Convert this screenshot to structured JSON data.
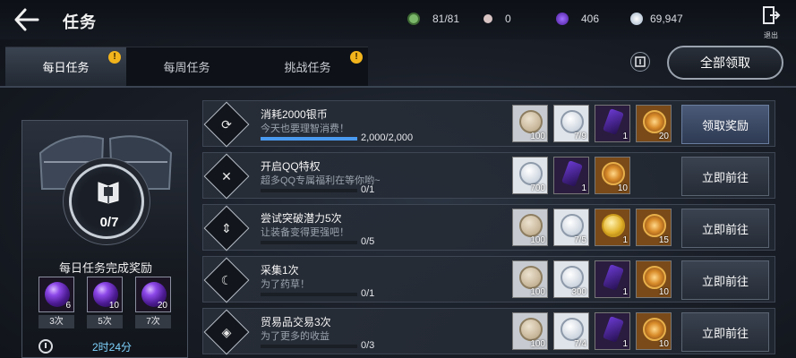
{
  "header": {
    "title": "任务",
    "exit_label": "退出"
  },
  "resources": [
    {
      "icon": "stamina-icon",
      "value": "81/81",
      "color": "#7bb86a"
    },
    {
      "icon": "pearl-icon",
      "value": "0",
      "color": "#d9c4c4"
    },
    {
      "icon": "purple-gem-icon",
      "value": "406",
      "color": "#7a3ee0"
    },
    {
      "icon": "silver-coin-icon",
      "value": "69,947",
      "color": "#c9d6e6"
    }
  ],
  "tabs": [
    {
      "label": "每日任务",
      "active": true,
      "badge": "!"
    },
    {
      "label": "每周任务",
      "active": false,
      "badge": ""
    },
    {
      "label": "挑战任务",
      "active": false,
      "badge": "!"
    }
  ],
  "claim_all_label": "全部领取",
  "daily_panel": {
    "count": "0/7",
    "title": "每日任务完成奖励",
    "rewards": [
      {
        "qty": "6",
        "label": "3次"
      },
      {
        "qty": "10",
        "label": "5次"
      },
      {
        "qty": "20",
        "label": "7次"
      }
    ],
    "timer": "2时24分"
  },
  "tasks": [
    {
      "name": "消耗2000银币",
      "desc": "今天也要理智消费！",
      "progress": "2,000/2,000",
      "progress_fraction": 1.0,
      "items": [
        {
          "type": "coin-tan",
          "bg": "bg-silver",
          "qty": "100"
        },
        {
          "type": "coin-silver",
          "bg": "bg-white",
          "qty": "7/9"
        },
        {
          "type": "gem",
          "bg": "bg-purple",
          "qty": "1"
        },
        {
          "type": "medal",
          "bg": "bg-gold",
          "qty": "20"
        }
      ],
      "button": "领取奖励",
      "claimable": true,
      "icon": "cycle-icon",
      "glyph": "⟳"
    },
    {
      "name": "开启QQ特权",
      "desc": "超多QQ专属福利在等你哟~",
      "progress": "0/1",
      "progress_fraction": 0,
      "items": [
        {
          "type": "coin-silver",
          "bg": "bg-white",
          "qty": "700"
        },
        {
          "type": "gem",
          "bg": "bg-purple",
          "qty": "1"
        },
        {
          "type": "medal",
          "bg": "bg-gold",
          "qty": "10"
        }
      ],
      "button": "立即前往",
      "claimable": false,
      "icon": "qq-privilege-icon",
      "glyph": "✕"
    },
    {
      "name": "尝试突破潜力5次",
      "desc": "让装备变得更强吧！",
      "progress": "0/5",
      "progress_fraction": 0,
      "items": [
        {
          "type": "coin-tan",
          "bg": "bg-silver",
          "qty": "100"
        },
        {
          "type": "coin-silver",
          "bg": "bg-white",
          "qty": "7/5"
        },
        {
          "type": "coin-gold",
          "bg": "bg-gold",
          "qty": "1"
        },
        {
          "type": "medal",
          "bg": "bg-gold",
          "qty": "15"
        }
      ],
      "button": "立即前往",
      "claimable": false,
      "icon": "breakthrough-icon",
      "glyph": "⇕"
    },
    {
      "name": "采集1次",
      "desc": "为了药草！",
      "progress": "0/1",
      "progress_fraction": 0,
      "items": [
        {
          "type": "coin-tan",
          "bg": "bg-silver",
          "qty": "100"
        },
        {
          "type": "coin-silver",
          "bg": "bg-white",
          "qty": "300"
        },
        {
          "type": "gem",
          "bg": "bg-purple",
          "qty": "1"
        },
        {
          "type": "medal",
          "bg": "bg-gold",
          "qty": "10"
        }
      ],
      "button": "立即前往",
      "claimable": false,
      "icon": "sickle-icon",
      "glyph": "☾"
    },
    {
      "name": "贸易品交易3次",
      "desc": "为了更多的收益",
      "progress": "0/3",
      "progress_fraction": 0,
      "items": [
        {
          "type": "coin-tan",
          "bg": "bg-silver",
          "qty": "100"
        },
        {
          "type": "coin-silver",
          "bg": "bg-white",
          "qty": "7/4"
        },
        {
          "type": "gem",
          "bg": "bg-purple",
          "qty": "1"
        },
        {
          "type": "medal",
          "bg": "bg-gold",
          "qty": "10"
        }
      ],
      "button": "立即前往",
      "claimable": false,
      "icon": "trade-icon",
      "glyph": "◈"
    }
  ]
}
